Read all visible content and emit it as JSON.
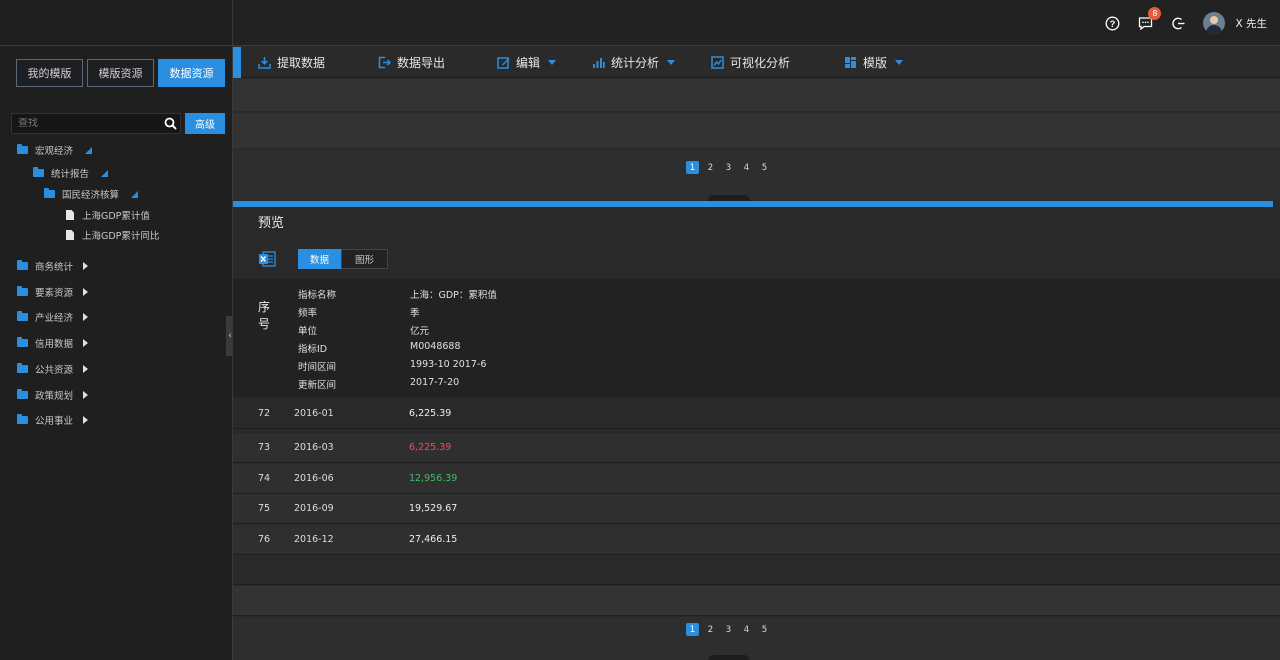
{
  "sidebar": {
    "tabs": [
      "我的模版",
      "模版资源",
      "数据资源"
    ],
    "active_tab": 2,
    "search": {
      "placeholder": "查找",
      "advanced_label": "高级"
    },
    "tree": {
      "root": "宏观经济",
      "child": "统计报告",
      "grandchild": "国民经济核算",
      "leaves": [
        "上海GDP累计值",
        "上海GDP累计同比"
      ],
      "others": [
        "商务统计",
        "要素资源",
        "产业经济",
        "信用数据",
        "公共资源",
        "政策规划",
        "公用事业"
      ]
    }
  },
  "header": {
    "notification_count": "8",
    "username": "X 先生"
  },
  "toolbar": {
    "items": [
      "提取数据",
      "数据导出",
      "编辑",
      "统计分析",
      "可视化分析",
      "模版"
    ]
  },
  "pagination": {
    "pages": [
      "1",
      "2",
      "3",
      "4",
      "5"
    ],
    "current": "1"
  },
  "preview": {
    "title": "预览",
    "view_tabs": [
      "数据",
      "图形"
    ],
    "seq_header": "序号",
    "meta": [
      {
        "label": "指标名称",
        "value": "上海：GDP：累积值"
      },
      {
        "label": "频率",
        "value": "季"
      },
      {
        "label": "单位",
        "value": "亿元"
      },
      {
        "label": "指标ID",
        "value": "M0048688"
      },
      {
        "label": "时间区间",
        "value": "1993-10 2017-6"
      },
      {
        "label": "更新区间",
        "value": "2017-7-20"
      }
    ],
    "rows": [
      {
        "seq": "72",
        "date": "2016-01",
        "value": "6,225.39",
        "color": "#eeeeee"
      },
      {
        "seq": "73",
        "date": "2016-03",
        "value": "6,225.39",
        "color": "#e8505b"
      },
      {
        "seq": "74",
        "date": "2016-06",
        "value": "12,956.39",
        "color": "#3fbf6b"
      },
      {
        "seq": "75",
        "date": "2016-09",
        "value": "19,529.67",
        "color": "#eeeeee"
      },
      {
        "seq": "76",
        "date": "2016-12",
        "value": "27,466.15",
        "color": "#eeeeee"
      }
    ]
  },
  "colors": {
    "accent": "#2a8fe0",
    "negative": "#e8505b",
    "positive": "#3fbf6b"
  }
}
